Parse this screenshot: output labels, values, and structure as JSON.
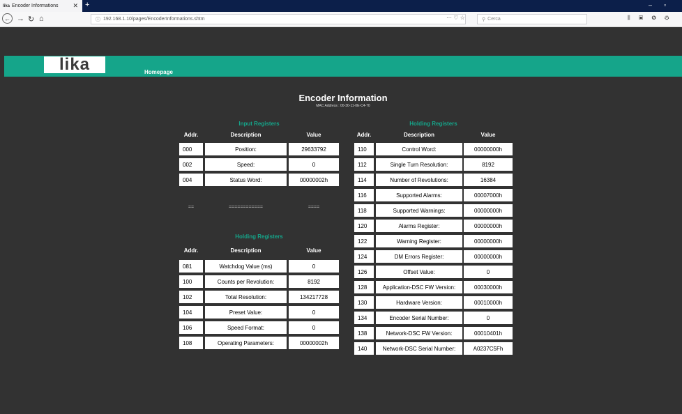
{
  "browser": {
    "tab_title": "Encoder Informations",
    "tab_favicon": "lika",
    "url": "192.168.1.10/pages/EncoderInformations.shtm",
    "search_placeholder": "Cerca"
  },
  "page": {
    "logo": "lika",
    "nav_home": "Homepage",
    "title": "Encoder Information",
    "mac": "MAC Address : 00-30-11-0E-C4-70"
  },
  "input_registers": {
    "title": "Input Registers",
    "headers": [
      "Addr.",
      "Description",
      "Value"
    ],
    "rows": [
      {
        "addr": "000",
        "desc": "Position:",
        "value": "29633792"
      },
      {
        "addr": "002",
        "desc": "Speed:",
        "value": "0"
      },
      {
        "addr": "004",
        "desc": "Status Word:",
        "value": "00000002h"
      }
    ],
    "separator": [
      "==",
      "============",
      "===="
    ]
  },
  "holding_registers_left": {
    "title": "Holding Registers",
    "headers": [
      "Addr.",
      "Description",
      "Value"
    ],
    "rows": [
      {
        "addr": "081",
        "desc": "Watchdog Value (ms)",
        "value": "0"
      },
      {
        "addr": "100",
        "desc": "Counts per Revolution:",
        "value": "8192"
      },
      {
        "addr": "102",
        "desc": "Total Resolution:",
        "value": "134217728"
      },
      {
        "addr": "104",
        "desc": "Preset Value:",
        "value": "0"
      },
      {
        "addr": "106",
        "desc": "Speed Format:",
        "value": "0"
      },
      {
        "addr": "108",
        "desc": "Operating Parameters:",
        "value": "00000002h"
      }
    ]
  },
  "holding_registers_right": {
    "title": "Holding Registers",
    "headers": [
      "Addr.",
      "Description",
      "Value"
    ],
    "rows": [
      {
        "addr": "110",
        "desc": "Control Word:",
        "value": "00000000h"
      },
      {
        "addr": "112",
        "desc": "Single Turn Resolution:",
        "value": "8192"
      },
      {
        "addr": "114",
        "desc": "Number of Revolutions:",
        "value": "16384"
      },
      {
        "addr": "116",
        "desc": "Supported Alarms:",
        "value": "00007000h"
      },
      {
        "addr": "118",
        "desc": "Supported Warnings:",
        "value": "00000000h"
      },
      {
        "addr": "120",
        "desc": "Alarms Register:",
        "value": "00000000h"
      },
      {
        "addr": "122",
        "desc": "Warning Register:",
        "value": "00000000h"
      },
      {
        "addr": "124",
        "desc": "DM Errors Register:",
        "value": "00000000h"
      },
      {
        "addr": "126",
        "desc": "Offset Value:",
        "value": "0"
      },
      {
        "addr": "128",
        "desc": "Application-DSC FW Version:",
        "value": "00030000h"
      },
      {
        "addr": "130",
        "desc": "Hardware Version:",
        "value": "00010000h"
      },
      {
        "addr": "134",
        "desc": "Encoder Serial Number:",
        "value": "0"
      },
      {
        "addr": "138",
        "desc": "Network-DSC FW Version:",
        "value": "00010401h"
      },
      {
        "addr": "140",
        "desc": "Network-DSC Serial Number:",
        "value": "A0237C5Fh"
      }
    ]
  },
  "colors": {
    "accent": "#15a58a",
    "background": "#323232"
  }
}
